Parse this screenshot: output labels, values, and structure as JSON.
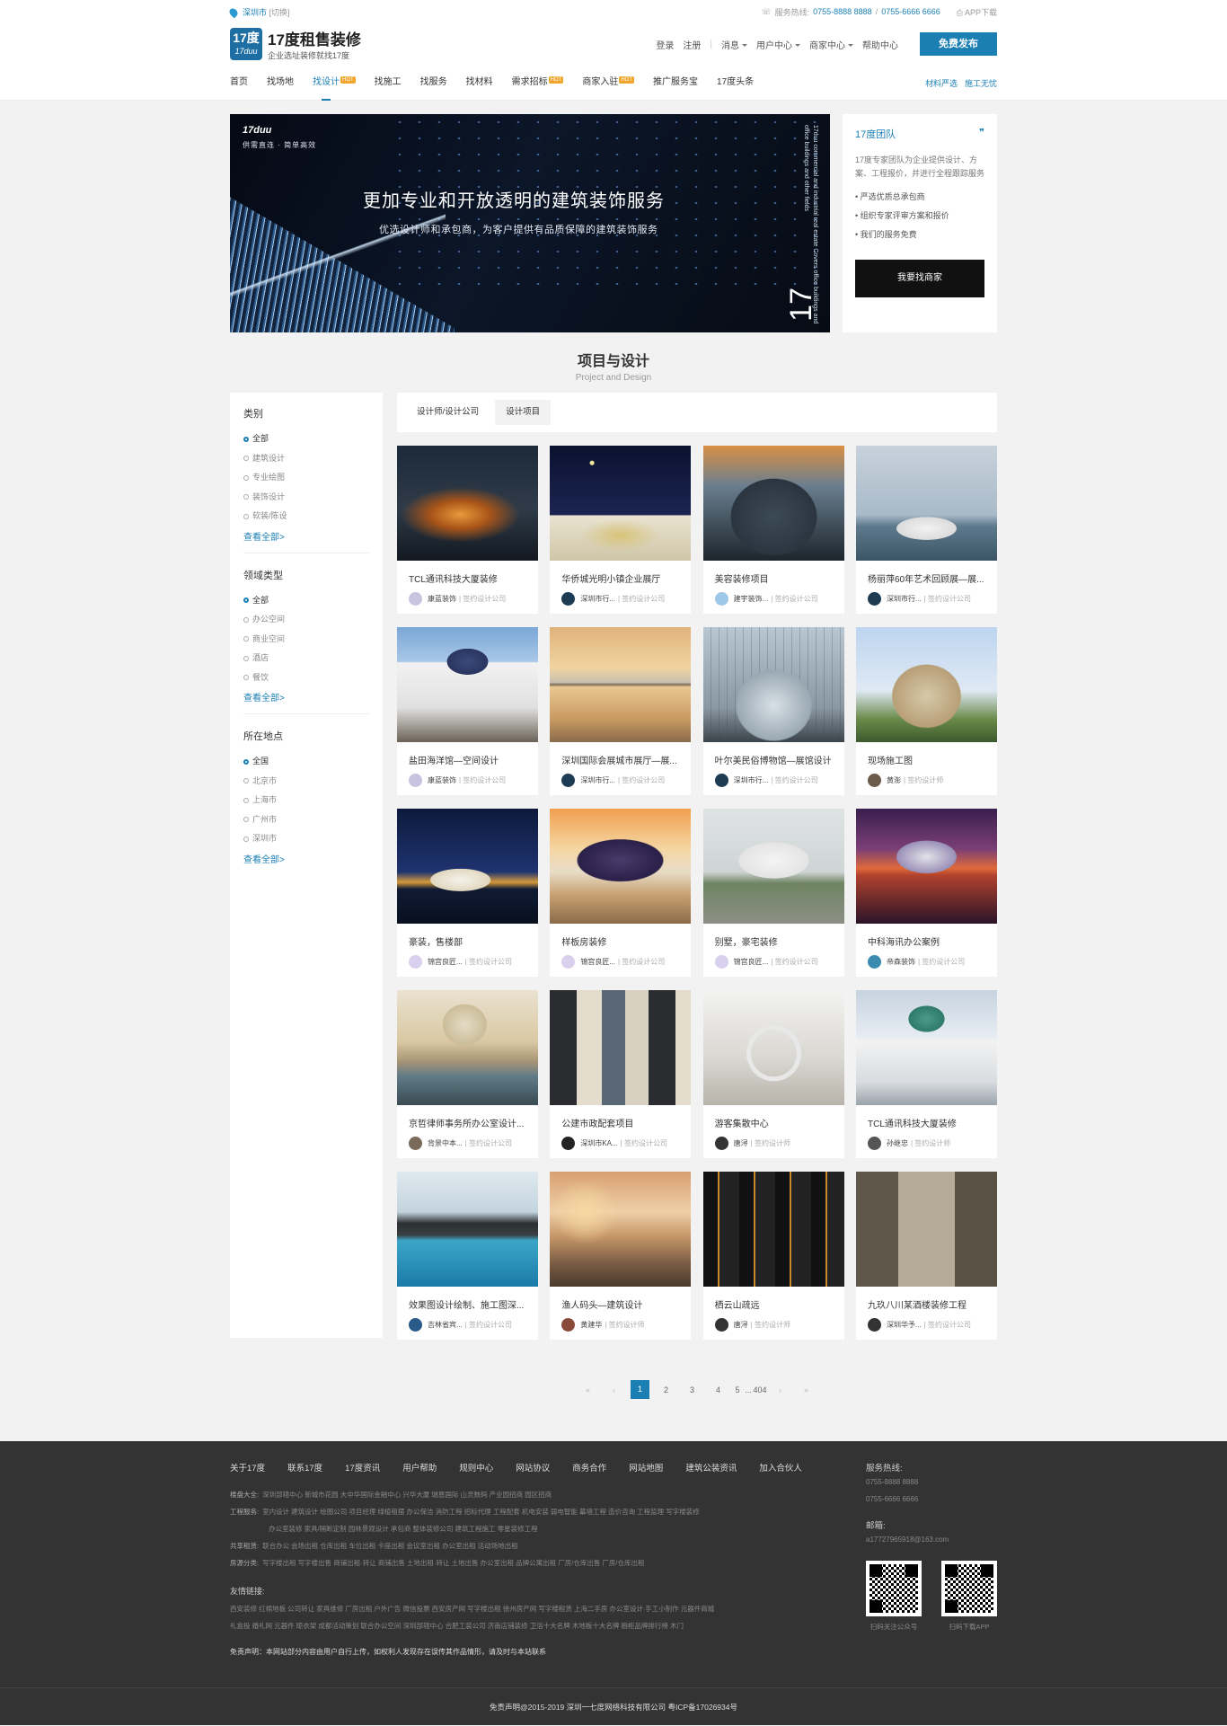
{
  "topbar": {
    "city": "深圳市",
    "switch": "[切换]",
    "hotline_label": "服务热线:",
    "phone1": "0755-8888 8888",
    "phone_sep": " / ",
    "phone2": "0755-6666 6666",
    "app": "APP下载"
  },
  "header": {
    "logo_big": "17度",
    "logo_small": "17duu",
    "title": "17度租售装修",
    "subtitle": "企业选址装修就找17度",
    "login": "登录",
    "register": "注册",
    "sep": "|",
    "messages": "消息",
    "user_center": "用户中心",
    "merchant_center": "商家中心",
    "help": "帮助中心",
    "publish": "免费发布"
  },
  "nav": {
    "items": [
      {
        "label": "首页",
        "badge": ""
      },
      {
        "label": "找场地",
        "badge": ""
      },
      {
        "label": "找设计",
        "badge": "HOT"
      },
      {
        "label": "找施工",
        "badge": ""
      },
      {
        "label": "找服务",
        "badge": ""
      },
      {
        "label": "找材料",
        "badge": ""
      },
      {
        "label": "需求招标",
        "badge": "HOT"
      },
      {
        "label": "商家入驻",
        "badge": "HOT"
      },
      {
        "label": "推广服务宝",
        "badge": ""
      },
      {
        "label": "17度头条",
        "badge": ""
      }
    ],
    "right1": "材料严选",
    "right2": "施工无忧"
  },
  "banner": {
    "brand": "17duu",
    "slogan": "供需直连 · 简单高效",
    "headline": "更加专业和开放透明的建筑装饰服务",
    "subline": "优选设计师和承包商，为客户提供有品质保障的建筑装饰服务",
    "vertical": "17duu commercial and industrial real estate Covers office buildings and office buildings and other fields",
    "num": "17"
  },
  "team": {
    "title": "17度团队",
    "desc": "17度专家团队为企业提供设计、方案、工程报价，并进行全程跟踪服务",
    "points": [
      "• 严选优质总承包商",
      "• 组织专家评审方案和报价",
      "• 我们的服务免费"
    ],
    "button": "我要找商家"
  },
  "section": {
    "title": "项目与设计",
    "subtitle": "Project and Design"
  },
  "sidebar": {
    "groups": [
      {
        "title": "类别",
        "options": [
          "全部",
          "建筑设计",
          "专业绘图",
          "装饰设计",
          "软装/陈设"
        ],
        "more": "查看全部>"
      },
      {
        "title": "领域类型",
        "options": [
          "全部",
          "办公空间",
          "商业空间",
          "酒店",
          "餐饮"
        ],
        "more": "查看全部>"
      },
      {
        "title": "所在地点",
        "options": [
          "全国",
          "北京市",
          "上海市",
          "广州市",
          "深圳市"
        ],
        "more": "查看全部>"
      }
    ]
  },
  "tabs": [
    "设计师/设计公司",
    "设计项目"
  ],
  "cards": [
    {
      "name": "TCL通讯科技大厦装修",
      "author": "康蓝装饰",
      "tag": "| 签约设计公司",
      "scene": "arena",
      "avatar": "#c8c4e0"
    },
    {
      "name": "华侨城光明小镇企业展厅",
      "author": "深圳市行...",
      "tag": "| 签约设计公司",
      "scene": "mosque-night",
      "avatar": "#1e3b54"
    },
    {
      "name": "美容装修项目",
      "author": "建宇装饰...",
      "tag": "| 签约设计公司",
      "scene": "dome",
      "avatar": "#9ec8e8"
    },
    {
      "name": "杨丽萍60年艺术回顾展—展...",
      "author": "深圳市行...",
      "tag": "| 签约设计公司",
      "scene": "opera-day",
      "avatar": "#1e3b54"
    },
    {
      "name": "盐田海洋馆—空间设计",
      "author": "康蓝装饰",
      "tag": "| 签约设计公司",
      "scene": "white-mosque",
      "avatar": "#c8c4e0"
    },
    {
      "name": "深圳国际会展城市展厅—展...",
      "author": "深圳市行...",
      "tag": "| 签约设计公司",
      "scene": "reflect-mosque",
      "avatar": "#1e3b54"
    },
    {
      "name": "叶尔美民俗博物馆—展馆设计",
      "author": "深圳市行...",
      "tag": "| 签约设计公司",
      "scene": "glass-dome",
      "avatar": "#1e3b54"
    },
    {
      "name": "现场施工图",
      "author": "黄澎",
      "tag": "| 签约设计师",
      "scene": "cathedral",
      "avatar": "#6b5a4a"
    },
    {
      "name": "豪装，售楼部",
      "author": "锦宫良匠...",
      "tag": "| 签约设计公司",
      "scene": "opera-night",
      "avatar": "#d8d0ec"
    },
    {
      "name": "样板房装修",
      "author": "锦宫良匠...",
      "tag": "| 签约设计公司",
      "scene": "palace",
      "avatar": "#d8d0ec"
    },
    {
      "name": "别墅，豪宅装修",
      "author": "锦宫良匠...",
      "tag": "| 签约设计公司",
      "scene": "fog-mosque",
      "avatar": "#d8d0ec"
    },
    {
      "name": "中科海讯办公案例",
      "author": "帝森装饰",
      "tag": "| 签约设计公司",
      "scene": "purple-mosque",
      "avatar": "#3c8cb0"
    },
    {
      "name": "京哲律师事务所办公室设计...",
      "author": "背景中本...",
      "tag": "| 签约设计公司",
      "scene": "rome",
      "avatar": "#7a6a5a"
    },
    {
      "name": "公建市政配套项目",
      "author": "深圳市KA...",
      "tag": "| 签约设计公司",
      "scene": "houses",
      "avatar": "#222"
    },
    {
      "name": "游客集散中心",
      "author": "唐浔",
      "tag": "| 签约设计师",
      "scene": "stair",
      "avatar": "#333"
    },
    {
      "name": "TCL通讯科技大厦装修",
      "author": "孙继忠",
      "tag": "| 签约设计师",
      "scene": "helsinki",
      "avatar": "#555"
    },
    {
      "name": "效果图设计绘制、施工图深...",
      "author": "吉林省宾...",
      "tag": "| 签约设计公司",
      "scene": "pool",
      "avatar": "#2a5a8a"
    },
    {
      "name": "渔人码头—建筑设计",
      "author": "黄建华",
      "tag": "| 签约设计师",
      "scene": "sunset-street",
      "avatar": "#8a4a3a"
    },
    {
      "name": "栖云山疏远",
      "author": "唐浔",
      "tag": "| 签约设计师",
      "scene": "mall",
      "avatar": "#333"
    },
    {
      "name": "九玖八川某酒楼装修工程",
      "author": "深圳华予...",
      "tag": "| 签约设计公司",
      "scene": "paris",
      "avatar": "#333"
    }
  ],
  "pagination": {
    "first": "«",
    "prev": "‹",
    "pages": [
      "1",
      "2",
      "3",
      "4",
      "5"
    ],
    "ellipsis": "...",
    "last_page": "404",
    "next": "›",
    "last": "»"
  },
  "footer": {
    "links": [
      "关于17度",
      "联系17度",
      "17度资讯",
      "用户帮助",
      "规则中心",
      "网站协议",
      "商务合作",
      "网站地图",
      "建筑公装资讯",
      "加入合伙人"
    ],
    "rows": [
      {
        "label": "楼盘大全:",
        "items": "深圳部辖中心  新城市花园  大中华国际金融中心  兴华大厦  瑞恩国际  山灵数码  产业园招商  园区招商"
      },
      {
        "label": "工程服务:",
        "items": "室内设计  建筑设计  绘图公司  项目经理  绿植租摆  办公保洁  消防工程  招标代理  工程配套  机电安装  弱电智能  幕墙工程  造价咨询  工程监理  写字楼装修"
      },
      {
        "label": "",
        "items": "办公室装修  家具/隔断定制  园林景观设计  承包商  整体装修公司  建筑工程施工  零星装修工程"
      },
      {
        "label": "共享租赁:",
        "items": "联合办公  会场出租  仓库出租  车位出租  卡座出租  会议室出租  办公室出租  活动场地出租"
      },
      {
        "label": "房源分类:",
        "items": "写字楼出租  写字楼出售  商铺出租·转让  商铺出售  土地出租·转让  土地出售  办公室出租  品牌公寓出租  厂房/仓库出售  厂房/仓库出租"
      }
    ],
    "friends_label": "友情链接:",
    "friends1": "西安装修  红棉地板  公司转让  家具维修  厂房出租  户外广告  微信投票  西安房产网  写字楼出租  徐州房产网  写字楼租赁  上海二手房  办公室设计  手工小制作  元器件商城",
    "friends2": "礼盒投  婚礼网  元器件  晾衣架  成都活动策划  联合办公空间  深圳部辖中心  合肥工装公司  济南店铺装修  卫浴十大名牌  木地板十大名牌  橱柜品牌排行榜  木门",
    "disclaimer": "免责声明：本网站部分内容由用户自行上传，如权利人发现存在误传其作品情形，请及时与本站联系",
    "hotline_title": "服务热线:",
    "hotline1": "0755-8888 8888",
    "hotline2": "0755-6666 6666",
    "email_title": "邮箱:",
    "email": "a17727965918@163.com",
    "qr1": "扫码关注公众号",
    "qr2": "扫码下载APP",
    "copyright": "免责声明@2015-2019 深圳一七度网络科技有限公司 粤ICP备17026934号"
  }
}
